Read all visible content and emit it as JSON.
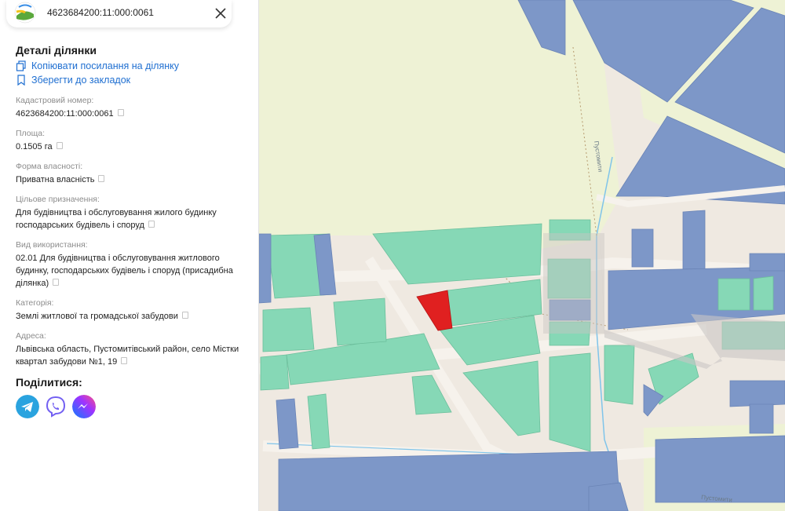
{
  "search": {
    "value": "4623684200:11:000:0061"
  },
  "details": {
    "title": "Деталі ділянки",
    "copy_link": "Копіювати посилання на ділянку",
    "save_bookmark": "Зберегти до закладок"
  },
  "fields": [
    {
      "label": "Кадастровий номер:",
      "lines": [
        "4623684200:11:000:0061"
      ]
    },
    {
      "label": "Площа:",
      "lines": [
        "0.1505 га"
      ]
    },
    {
      "label": "Форма власності:",
      "lines": [
        "Приватна власність"
      ]
    },
    {
      "label": "Цільове призначення:",
      "lines": [
        "Для будівництва і обслуговування жилого будинку",
        "господарських будівель і споруд"
      ]
    },
    {
      "label": "Вид використання:",
      "lines": [
        "02.01 Для будівництва і обслуговування житлового",
        "будинку, господарських будівель і споруд (присадибна",
        "ділянка)"
      ]
    },
    {
      "label": "Категорія:",
      "lines": [
        "Землі житлової та громадської забудови"
      ]
    },
    {
      "label": "Адреса:",
      "lines": [
        "Львівська область, Пустомитівський район, село Містки",
        "квартал забудови №1, 19"
      ]
    }
  ],
  "share": {
    "title": "Поділитися:",
    "buttons": [
      {
        "name": "telegram",
        "color": "#2aa3df"
      },
      {
        "name": "viber",
        "color": "#7360f2"
      },
      {
        "name": "messenger",
        "color": "#a033ff"
      }
    ]
  },
  "map": {
    "labels": [
      "Пустомити",
      "Пустомити"
    ],
    "colors": {
      "background": "#efe9e1",
      "field": "#eef2d5",
      "parcel_green": "#86d8b6",
      "parcel_blue": "#7d97c8",
      "selected": "#e02020",
      "road_blue": "#7fc4ea",
      "boundary": "#b69a6e"
    }
  }
}
